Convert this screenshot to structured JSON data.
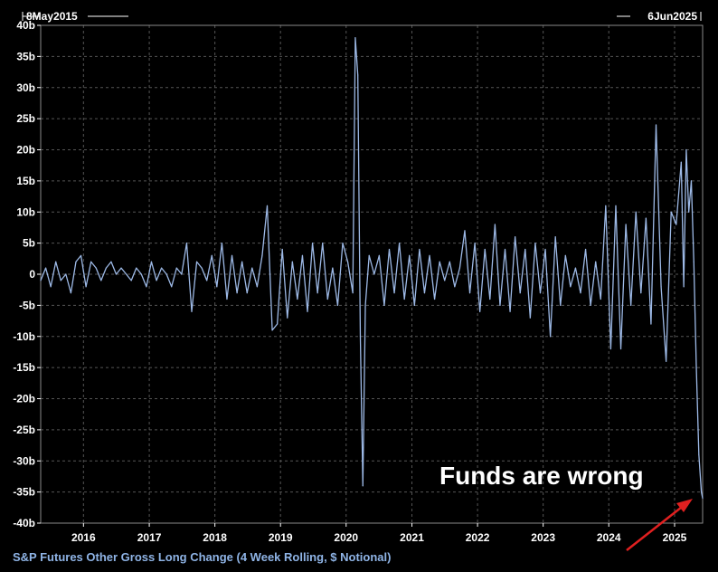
{
  "chart_data": {
    "type": "line",
    "title": "",
    "xlabel": "",
    "ylabel": "",
    "start_date_label": "8May2015",
    "end_date_label": "6Jun2025",
    "xlim": [
      "2015-05-08",
      "2025-06-06"
    ],
    "ylim": [
      -40,
      40
    ],
    "y_unit_suffix": "b",
    "y_ticks": [
      40,
      35,
      30,
      25,
      20,
      15,
      10,
      5,
      0,
      -5,
      -10,
      -15,
      -20,
      -25,
      -30,
      -35,
      -40
    ],
    "y_tick_labels": [
      "40b",
      "35b",
      "30b",
      "25b",
      "20b",
      "15b",
      "10b",
      "5b",
      "0",
      "-5b",
      "-10b",
      "-15b",
      "-20b",
      "-25b",
      "-30b",
      "-35b",
      "-40b"
    ],
    "x_tick_labels": [
      "2016",
      "2017",
      "2018",
      "2019",
      "2020",
      "2021",
      "2022",
      "2023",
      "2024",
      "2025"
    ],
    "x_ticks": [
      "2016-01-01",
      "2017-01-01",
      "2018-01-01",
      "2019-01-01",
      "2020-01-01",
      "2021-01-01",
      "2022-01-01",
      "2023-01-01",
      "2024-01-01",
      "2025-01-01"
    ],
    "grid": true,
    "legend": "bottom-left",
    "series": [
      {
        "name": "S&P Futures Other Gross Long Change (4 Week Rolling, $ Notional)",
        "color": "#9db9e6",
        "points": [
          [
            "2015-05-08",
            -1
          ],
          [
            "2015-06-05",
            1
          ],
          [
            "2015-07-03",
            -2
          ],
          [
            "2015-07-31",
            2
          ],
          [
            "2015-08-28",
            -1
          ],
          [
            "2015-09-25",
            0
          ],
          [
            "2015-10-23",
            -3
          ],
          [
            "2015-11-20",
            2
          ],
          [
            "2015-12-18",
            3
          ],
          [
            "2016-01-15",
            -2
          ],
          [
            "2016-02-12",
            2
          ],
          [
            "2016-03-11",
            1
          ],
          [
            "2016-04-08",
            -1
          ],
          [
            "2016-05-06",
            1
          ],
          [
            "2016-06-03",
            2
          ],
          [
            "2016-07-01",
            0
          ],
          [
            "2016-07-29",
            1
          ],
          [
            "2016-08-26",
            0
          ],
          [
            "2016-09-23",
            -1
          ],
          [
            "2016-10-21",
            1
          ],
          [
            "2016-11-18",
            0
          ],
          [
            "2016-12-16",
            -2
          ],
          [
            "2017-01-13",
            2
          ],
          [
            "2017-02-10",
            -1
          ],
          [
            "2017-03-10",
            1
          ],
          [
            "2017-04-07",
            0
          ],
          [
            "2017-05-05",
            -2
          ],
          [
            "2017-06-02",
            1
          ],
          [
            "2017-06-30",
            0
          ],
          [
            "2017-07-28",
            5
          ],
          [
            "2017-08-25",
            -6
          ],
          [
            "2017-09-22",
            2
          ],
          [
            "2017-10-20",
            1
          ],
          [
            "2017-11-17",
            -1
          ],
          [
            "2017-12-15",
            3
          ],
          [
            "2018-01-12",
            -2
          ],
          [
            "2018-02-09",
            5
          ],
          [
            "2018-03-09",
            -4
          ],
          [
            "2018-04-06",
            3
          ],
          [
            "2018-05-04",
            -3
          ],
          [
            "2018-06-01",
            2
          ],
          [
            "2018-06-29",
            -3
          ],
          [
            "2018-07-27",
            1
          ],
          [
            "2018-08-24",
            -2
          ],
          [
            "2018-09-21",
            3
          ],
          [
            "2018-10-19",
            11
          ],
          [
            "2018-11-16",
            -9
          ],
          [
            "2018-12-14",
            -8
          ],
          [
            "2019-01-11",
            4
          ],
          [
            "2019-02-08",
            -7
          ],
          [
            "2019-03-08",
            2
          ],
          [
            "2019-04-05",
            -4
          ],
          [
            "2019-05-03",
            3
          ],
          [
            "2019-05-31",
            -6
          ],
          [
            "2019-06-28",
            5
          ],
          [
            "2019-07-26",
            -3
          ],
          [
            "2019-08-23",
            5
          ],
          [
            "2019-09-20",
            -4
          ],
          [
            "2019-10-18",
            1
          ],
          [
            "2019-11-15",
            -5
          ],
          [
            "2019-12-13",
            5
          ],
          [
            "2020-01-10",
            2
          ],
          [
            "2020-02-07",
            -3
          ],
          [
            "2020-02-21",
            38
          ],
          [
            "2020-03-06",
            32
          ],
          [
            "2020-03-20",
            -10
          ],
          [
            "2020-04-03",
            -34
          ],
          [
            "2020-04-17",
            -5
          ],
          [
            "2020-05-08",
            3
          ],
          [
            "2020-06-05",
            0
          ],
          [
            "2020-07-03",
            3
          ],
          [
            "2020-07-31",
            -5
          ],
          [
            "2020-08-28",
            4
          ],
          [
            "2020-09-25",
            -3
          ],
          [
            "2020-10-23",
            5
          ],
          [
            "2020-11-20",
            -4
          ],
          [
            "2020-12-18",
            3
          ],
          [
            "2021-01-15",
            -5
          ],
          [
            "2021-02-12",
            4
          ],
          [
            "2021-03-12",
            -3
          ],
          [
            "2021-04-09",
            3
          ],
          [
            "2021-05-07",
            -4
          ],
          [
            "2021-06-04",
            2
          ],
          [
            "2021-07-02",
            -1
          ],
          [
            "2021-07-30",
            2
          ],
          [
            "2021-08-27",
            -2
          ],
          [
            "2021-09-24",
            1
          ],
          [
            "2021-10-22",
            7
          ],
          [
            "2021-11-19",
            -3
          ],
          [
            "2021-12-17",
            5
          ],
          [
            "2022-01-14",
            -6
          ],
          [
            "2022-02-11",
            4
          ],
          [
            "2022-03-11",
            -4
          ],
          [
            "2022-04-08",
            8
          ],
          [
            "2022-05-06",
            -5
          ],
          [
            "2022-06-03",
            4
          ],
          [
            "2022-07-01",
            -6
          ],
          [
            "2022-07-29",
            6
          ],
          [
            "2022-08-26",
            -3
          ],
          [
            "2022-09-23",
            4
          ],
          [
            "2022-10-21",
            -7
          ],
          [
            "2022-11-18",
            5
          ],
          [
            "2022-12-16",
            -3
          ],
          [
            "2023-01-13",
            4
          ],
          [
            "2023-02-10",
            -10
          ],
          [
            "2023-03-10",
            6
          ],
          [
            "2023-04-07",
            -5
          ],
          [
            "2023-05-05",
            3
          ],
          [
            "2023-06-02",
            -2
          ],
          [
            "2023-06-30",
            1
          ],
          [
            "2023-07-28",
            -3
          ],
          [
            "2023-08-25",
            4
          ],
          [
            "2023-09-22",
            -5
          ],
          [
            "2023-10-20",
            2
          ],
          [
            "2023-11-17",
            -4
          ],
          [
            "2023-12-15",
            11
          ],
          [
            "2024-01-12",
            -12
          ],
          [
            "2024-02-09",
            11
          ],
          [
            "2024-03-08",
            -12
          ],
          [
            "2024-04-05",
            8
          ],
          [
            "2024-05-03",
            -5
          ],
          [
            "2024-05-31",
            10
          ],
          [
            "2024-06-28",
            -3
          ],
          [
            "2024-07-26",
            9
          ],
          [
            "2024-08-23",
            -8
          ],
          [
            "2024-09-20",
            24
          ],
          [
            "2024-10-18",
            -2
          ],
          [
            "2024-11-15",
            -14
          ],
          [
            "2024-12-13",
            10
          ],
          [
            "2025-01-10",
            8
          ],
          [
            "2025-02-07",
            18
          ],
          [
            "2025-02-21",
            -2
          ],
          [
            "2025-03-07",
            20
          ],
          [
            "2025-03-21",
            10
          ],
          [
            "2025-04-04",
            15
          ],
          [
            "2025-04-18",
            2
          ],
          [
            "2025-05-02",
            -15
          ],
          [
            "2025-05-16",
            -29
          ],
          [
            "2025-05-30",
            -35
          ],
          [
            "2025-06-06",
            -36
          ]
        ]
      }
    ],
    "annotation": "Funds are wrong",
    "annotation_color": "#ffffff",
    "arrow_color": "#e02020"
  },
  "colors": {
    "background": "#000000",
    "plot_border": "#8a8a8a",
    "grid": "#555555",
    "axis_text": "#ffffff"
  }
}
